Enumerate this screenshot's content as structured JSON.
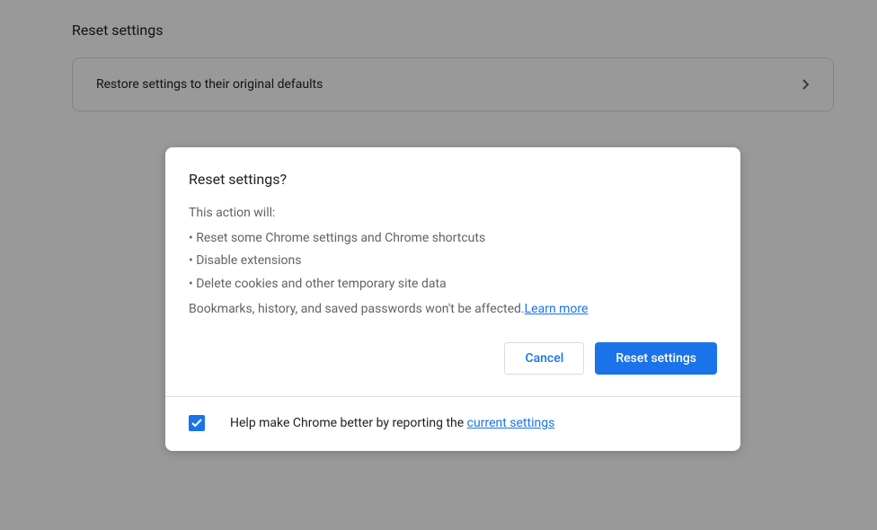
{
  "page": {
    "section_title": "Reset settings",
    "restore_row_label": "Restore settings to their original defaults"
  },
  "dialog": {
    "title": "Reset settings?",
    "intro": "This action will:",
    "bullets": [
      "• Reset some Chrome settings and Chrome shortcuts",
      "• Disable extensions",
      "• Delete cookies and other temporary site data"
    ],
    "preserve_note": "Bookmarks, history, and saved passwords won't be affected.",
    "learn_more": "Learn more",
    "cancel_label": "Cancel",
    "confirm_label": "Reset settings",
    "footer_prefix": "Help make Chrome better by reporting the ",
    "footer_link": "current settings"
  }
}
